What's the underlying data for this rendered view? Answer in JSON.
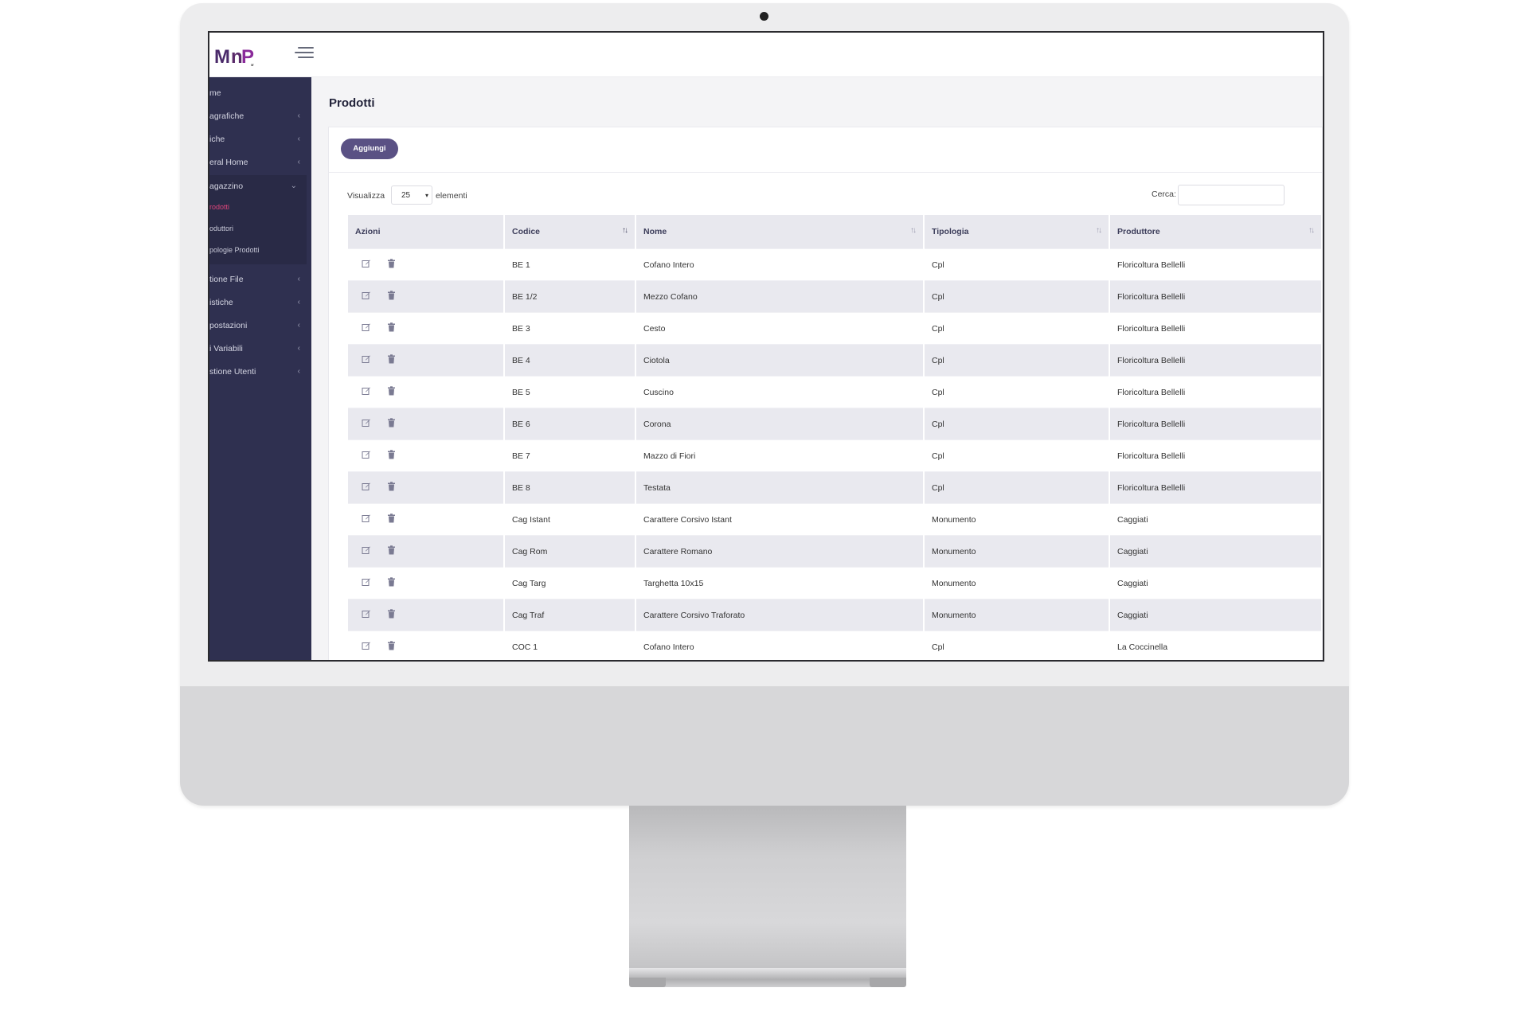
{
  "app": {
    "logo_text": "MnP",
    "logo_sub": "MT"
  },
  "sidebar": {
    "items": [
      {
        "label": "me",
        "has_chevron": false
      },
      {
        "label": "agrafiche",
        "has_chevron": true
      },
      {
        "label": "iche",
        "has_chevron": true
      },
      {
        "label": "eral Home",
        "has_chevron": true
      },
      {
        "label": "agazzino",
        "has_chevron": true,
        "expanded": true
      },
      {
        "label": "tione File",
        "has_chevron": true
      },
      {
        "label": "istiche",
        "has_chevron": true
      },
      {
        "label": "postazioni",
        "has_chevron": true
      },
      {
        "label": "i Variabili",
        "has_chevron": true
      },
      {
        "label": "stione Utenti",
        "has_chevron": true
      }
    ],
    "submenu": [
      {
        "label": "rodotti",
        "active": true
      },
      {
        "label": "oduttori",
        "active": false
      },
      {
        "label": "pologie Prodotti",
        "active": false
      }
    ],
    "chevron_left": "‹",
    "chevron_down": "⌄"
  },
  "main": {
    "title": "Prodotti",
    "add_button": "Aggiungi",
    "show_label": "Visualizza",
    "page_size": "25",
    "show_after": "elementi",
    "search_label": "Cerca:",
    "search_value": ""
  },
  "table": {
    "columns": [
      "Azioni",
      "Codice",
      "Nome",
      "Tipologia",
      "Produttore"
    ],
    "sort_icon": "↑↓",
    "rows": [
      {
        "codice": "BE 1",
        "nome": "Cofano Intero",
        "tipologia": "Cpl",
        "produttore": "Floricoltura Bellelli"
      },
      {
        "codice": "BE 1/2",
        "nome": "Mezzo Cofano",
        "tipologia": "Cpl",
        "produttore": "Floricoltura Bellelli"
      },
      {
        "codice": "BE 3",
        "nome": "Cesto",
        "tipologia": "Cpl",
        "produttore": "Floricoltura Bellelli"
      },
      {
        "codice": "BE 4",
        "nome": "Ciotola",
        "tipologia": "Cpl",
        "produttore": "Floricoltura Bellelli"
      },
      {
        "codice": "BE 5",
        "nome": "Cuscino",
        "tipologia": "Cpl",
        "produttore": "Floricoltura Bellelli"
      },
      {
        "codice": "BE 6",
        "nome": "Corona",
        "tipologia": "Cpl",
        "produttore": "Floricoltura Bellelli"
      },
      {
        "codice": "BE 7",
        "nome": "Mazzo di Fiori",
        "tipologia": "Cpl",
        "produttore": "Floricoltura Bellelli"
      },
      {
        "codice": "BE 8",
        "nome": "Testata",
        "tipologia": "Cpl",
        "produttore": "Floricoltura Bellelli"
      },
      {
        "codice": "Cag Istant",
        "nome": "Carattere Corsivo Istant",
        "tipologia": "Monumento",
        "produttore": "Caggiati"
      },
      {
        "codice": "Cag Rom",
        "nome": "Carattere Romano",
        "tipologia": "Monumento",
        "produttore": "Caggiati"
      },
      {
        "codice": "Cag Targ",
        "nome": "Targhetta 10x15",
        "tipologia": "Monumento",
        "produttore": "Caggiati"
      },
      {
        "codice": "Cag Traf",
        "nome": "Carattere Corsivo Traforato",
        "tipologia": "Monumento",
        "produttore": "Caggiati"
      },
      {
        "codice": "COC 1",
        "nome": "Cofano Intero",
        "tipologia": "Cpl",
        "produttore": "La Coccinella"
      }
    ]
  },
  "icons": {
    "edit": "edit-icon",
    "delete": "trash-icon",
    "menu": "hamburger-icon"
  },
  "colors": {
    "sidebar": "#2f3050",
    "accent_button": "#5a5184",
    "active_submenu": "#e0457b"
  }
}
